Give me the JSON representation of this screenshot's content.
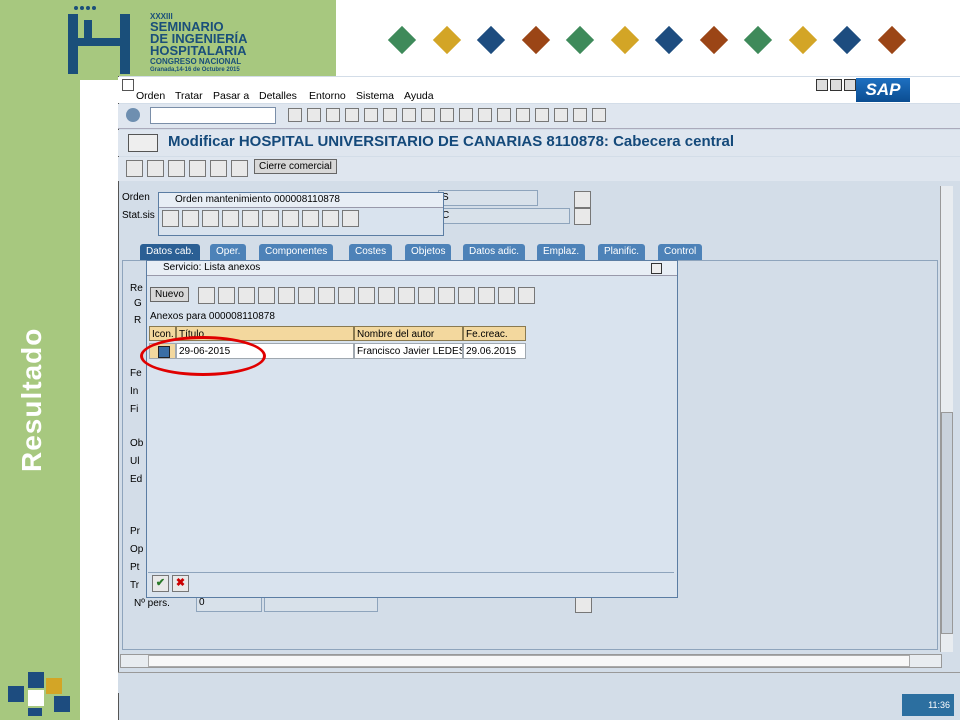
{
  "slide": {
    "side_title": "Resultado",
    "logo_lines": [
      "XXXIII",
      "SEMINARIO",
      "DE INGENIERÍA",
      "HOSPITALARIA",
      "CONGRESO NACIONAL",
      "Granada,14-16 de Octubre 2015"
    ],
    "diamond_colors": [
      "#3e8a5a",
      "#d3a526",
      "#1d4c7f",
      "#9b4516",
      "#3e8a5a",
      "#d3a526",
      "#1d4c7f",
      "#9b4516",
      "#3e8a5a",
      "#d3a526",
      "#1d4c7f",
      "#9b4516"
    ],
    "brand_green": "#a7c87f"
  },
  "sap": {
    "menu": [
      "Orden",
      "Tratar",
      "Pasar a",
      "Detalles",
      "Entorno",
      "Sistema",
      "Ayuda"
    ],
    "brand": "SAP",
    "title": "Modificar HOSPITAL UNIVERSITARIO DE CANARIAS 8110878: Cabecera central",
    "cierre_button": "Cierre comercial",
    "header_labels": {
      "orden": "Orden",
      "statsis": "Stat.sis"
    },
    "field_fragments": {
      "s": "S",
      "c": "C"
    },
    "tabs": [
      "Datos cab.",
      "Oper.",
      "Componentes",
      "Costes",
      "Objetos",
      "Datos adic.",
      "Emplaz.",
      "Planific.",
      "Control"
    ],
    "left_labels": [
      "Re",
      "G",
      "R",
      "Fe",
      "In",
      "Fi",
      "Ob",
      "Ul",
      "Ed",
      "Pr",
      "Op",
      "Pt",
      "Tr"
    ],
    "npers_label": "Nº pers.",
    "npers_value": "0",
    "clock": "11:36"
  },
  "popup_orden": {
    "title": "Orden mantenimiento 000008110878"
  },
  "popup_anexos": {
    "title": "Servicio: Lista anexos",
    "new_button": "Nuevo",
    "heading": "Anexos para 000008110878",
    "columns": [
      "Icon.",
      "Título",
      "Nombre del autor",
      "Fe.creac."
    ],
    "rows": [
      {
        "titulo": "29-06-2015",
        "autor": "Francisco Javier LEDES",
        "fecha": "29.06.2015"
      }
    ]
  }
}
